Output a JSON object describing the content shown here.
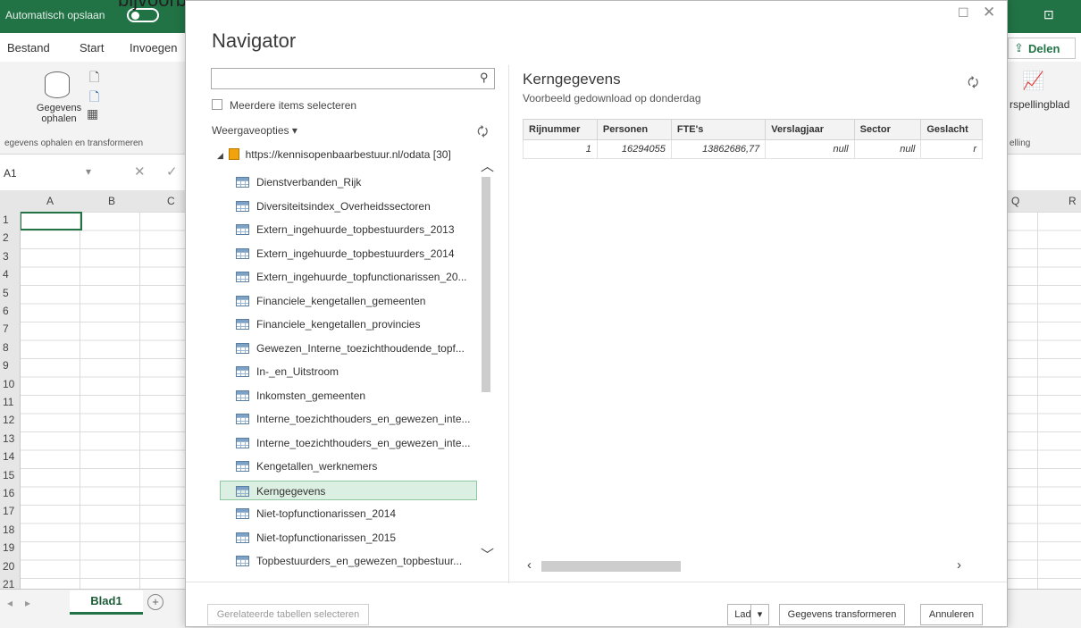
{
  "excel": {
    "autosave_label": "Automatisch opslaan",
    "top_overlay_text": "bijvoorbeeld \"Kerngegevens\"",
    "ribbon_tabs": [
      "Bestand",
      "Start",
      "Invoegen"
    ],
    "share_label": "Delen",
    "ribbon_group_button": "Gegevens ophalen",
    "ribbon_group_caption": "egevens ophalen en transformeren",
    "ribbon_right_label": "rspellingblad",
    "ribbon_right_caption": "elling",
    "cell_ref": "A1",
    "columns": [
      "A",
      "B",
      "C",
      "Q",
      "R"
    ],
    "rows": [
      "1",
      "2",
      "3",
      "4",
      "5",
      "6",
      "7",
      "8",
      "9",
      "10",
      "11",
      "12",
      "13",
      "14",
      "15",
      "16",
      "17",
      "18",
      "19",
      "20",
      "21"
    ],
    "sheet_tab": "Blad1"
  },
  "navigator": {
    "title": "Navigator",
    "search_placeholder": "",
    "multi_select_label": "Meerdere items selecteren",
    "view_options_label": "Weergaveopties",
    "root_label": "https://kennisopenbaarbestuur.nl/odata [30]",
    "items": [
      "Dienstverbanden_Rijk",
      "Diversiteitsindex_Overheidssectoren",
      "Extern_ingehuurde_topbestuurders_2013",
      "Extern_ingehuurde_topbestuurders_2014",
      "Extern_ingehuurde_topfunctionarissen_20...",
      "Financiele_kengetallen_gemeenten",
      "Financiele_kengetallen_provincies",
      "Gewezen_Interne_toezichthoudende_topf...",
      "In-_en_Uitstroom",
      "Inkomsten_gemeenten",
      "Interne_toezichthouders_en_gewezen_inte...",
      "Interne_toezichthouders_en_gewezen_inte...",
      "Kengetallen_werknemers",
      "Kerngegevens",
      "Niet-topfunctionarissen_2014",
      "Niet-topfunctionarissen_2015",
      "Topbestuurders_en_gewezen_topbestuur..."
    ],
    "selected_index": 13
  },
  "preview": {
    "title": "Kerngegevens",
    "subtitle": "Voorbeeld gedownload op donderdag",
    "columns": [
      "Rijnummer",
      "Personen",
      "FTE's",
      "Verslagjaar",
      "Sector",
      "Geslacht"
    ],
    "row": [
      "1",
      "16294055",
      "13862686,77",
      "null",
      "null",
      "r"
    ]
  },
  "footer": {
    "related_tables": "Gerelateerde tabellen selecteren",
    "load": "Laden",
    "transform": "Gegevens transformeren",
    "cancel": "Annuleren"
  }
}
